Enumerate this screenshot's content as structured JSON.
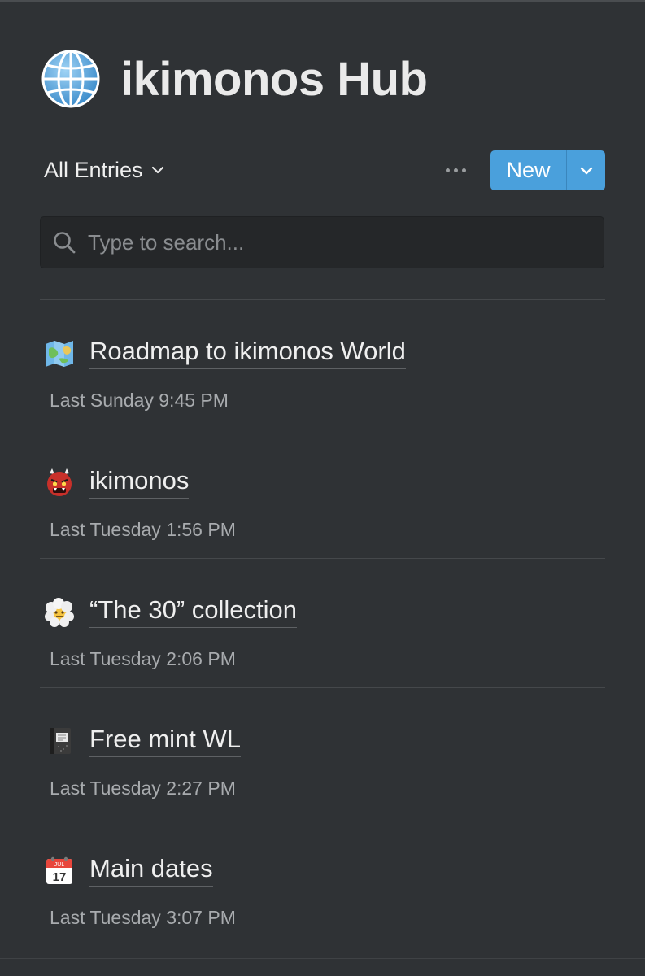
{
  "page": {
    "title": "ikimonos Hub",
    "icon": "globe-icon"
  },
  "toolbar": {
    "view_label": "All Entries",
    "more_icon": "ellipsis-icon",
    "new_label": "New",
    "accent_color": "#4aa0dc"
  },
  "search": {
    "placeholder": "Type to search...",
    "value": ""
  },
  "entries": [
    {
      "icon": "map-icon",
      "title": "Roadmap to ikimonos World",
      "time": "Last Sunday 9:45 PM"
    },
    {
      "icon": "ogre-icon",
      "title": "ikimonos",
      "time": "Last Tuesday 1:56 PM"
    },
    {
      "icon": "face-in-clouds-icon",
      "title": "“The 30” collection",
      "time": "Last Tuesday 2:06 PM"
    },
    {
      "icon": "notebook-icon",
      "title": "Free mint WL",
      "time": "Last Tuesday 2:27 PM"
    },
    {
      "icon": "calendar-icon",
      "title": "Main dates",
      "time": "Last Tuesday 3:07 PM"
    }
  ],
  "calendar_icon_text": {
    "month": "JUL",
    "day": "17"
  }
}
